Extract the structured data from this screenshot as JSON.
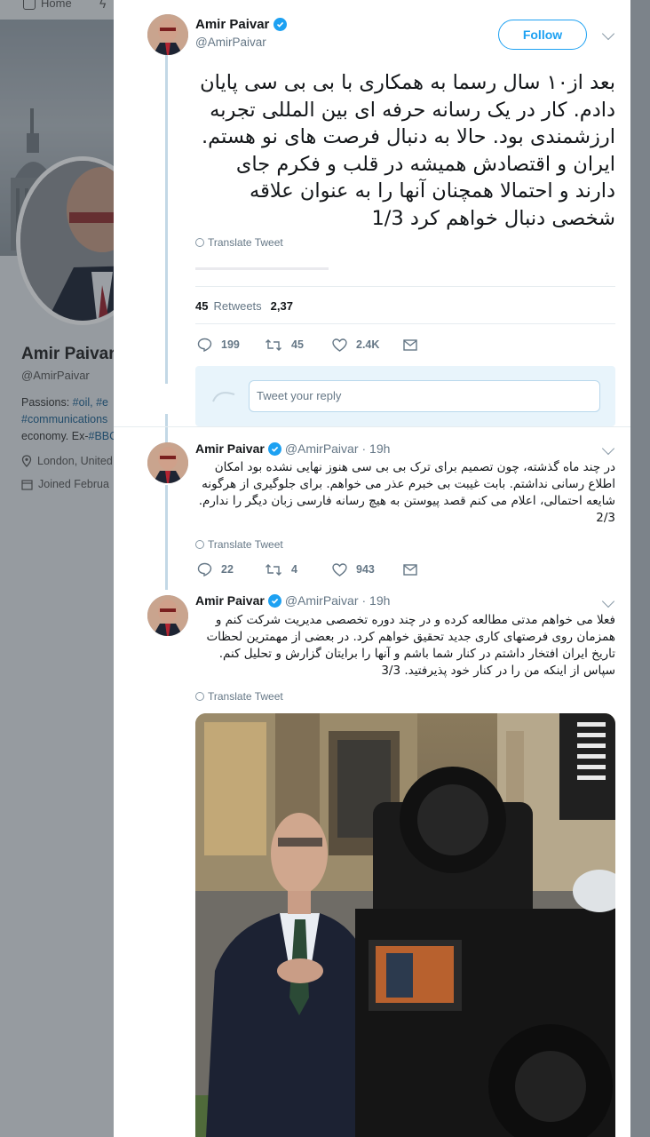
{
  "background": {
    "nav_home": "Home",
    "profile_name": "Amir Paivar",
    "profile_handle": "@AmirPaivar",
    "bio_line1_prefix": "Passions: ",
    "bio_line1_tags": "#oil, #e",
    "bio_line2": "#communications",
    "bio_line3_prefix": "economy. Ex-",
    "bio_line3_tag": "#BBC",
    "location": "London, United",
    "joined": "Joined Februa"
  },
  "main_tweet": {
    "author_name": "Amir Paivar",
    "author_handle": "@AmirPaivar",
    "follow_label": "Follow",
    "text": "بعد از۱۰ سال رسما به همکاری با بی بی سی پایان دادم. کار در یک رسانه حرفه ای بین المللی تجربه ارزشمندی بود. حالا به دنبال فرصت های نو هستم. ایران و اقتصادش همیشه در قلب و فکرم جای دارند و احتمالا همچنان آنها را به عنوان علاقه شخصی دنبال خواهم کرد 1/3",
    "translate_label": "Translate Tweet",
    "retweets_count": "45",
    "retweets_label": "Retweets",
    "likes_partial": "2,37",
    "reply_count": "199",
    "retweet_count": "45",
    "like_count": "2.4K",
    "reply_placeholder": "Tweet your reply"
  },
  "replies": [
    {
      "author_name": "Amir Paivar",
      "author_handle": "@AmirPaivar",
      "time": "· 19h",
      "text": "در چند ماه گذشته، چون تصمیم برای ترک بی بی سی هنوز نهایی نشده بود امکان اطلاع رسانی نداشتم. بابت غیبت بی خبرم عذر می خواهم. برای جلوگیری از هرگونه شایعه احتمالی، اعلام می کنم قصد پیوستن به هیچ رسانه فارسی زبان دیگر را ندارم. 2/3",
      "translate_label": "Translate Tweet",
      "reply_count": "22",
      "retweet_count": "4",
      "like_count": "943"
    },
    {
      "author_name": "Amir Paivar",
      "author_handle": "@AmirPaivar",
      "time": "· 19h",
      "text": "فعلا می خواهم مدتی مطالعه کرده و در چند دوره تخصصی مدیریت شرکت کنم و همزمان روی فرصتهای کاری جدید تحقیق خواهم کرد. در بعضی از مهمترین لحظات تاریخ ایران افتخار داشتم در کنار شما باشم و آنها را برایتان گزارش و تحلیل کنم. سپاس از اینکه من را در کنار خود پذیرفتید. 3/3",
      "translate_label": "Translate Tweet"
    }
  ],
  "colors": {
    "accent": "#1da1f2",
    "thread_line": "#c3d8e6",
    "muted_text": "#657786"
  }
}
